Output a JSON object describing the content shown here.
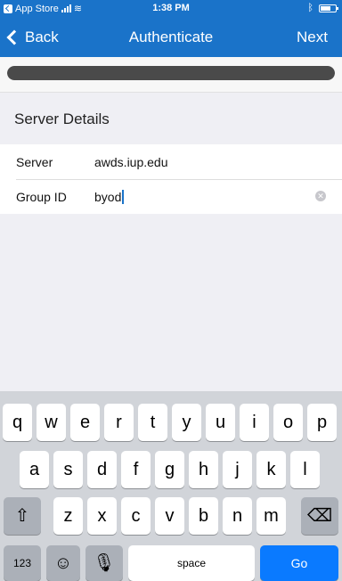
{
  "status": {
    "carrier": "App Store",
    "time": "1:38 PM"
  },
  "nav": {
    "back_label": "Back",
    "title": "Authenticate",
    "next_label": "Next"
  },
  "progress": {
    "value": 1.0
  },
  "section": {
    "title": "Server Details"
  },
  "fields": [
    {
      "label": "Server",
      "value": "awds.iup.edu"
    },
    {
      "label": "Group ID",
      "value": "byod"
    }
  ],
  "keyboard": {
    "row1": [
      "q",
      "w",
      "e",
      "r",
      "t",
      "y",
      "u",
      "i",
      "o",
      "p"
    ],
    "row2": [
      "a",
      "s",
      "d",
      "f",
      "g",
      "h",
      "j",
      "k",
      "l"
    ],
    "row3": [
      "z",
      "x",
      "c",
      "v",
      "b",
      "n",
      "m"
    ],
    "numbers_label": "123",
    "space_label": "space",
    "go_label": "Go"
  },
  "colors": {
    "nav": "#1a73c9",
    "go_key": "#0a7aff",
    "progress": "#4a4a4a"
  }
}
